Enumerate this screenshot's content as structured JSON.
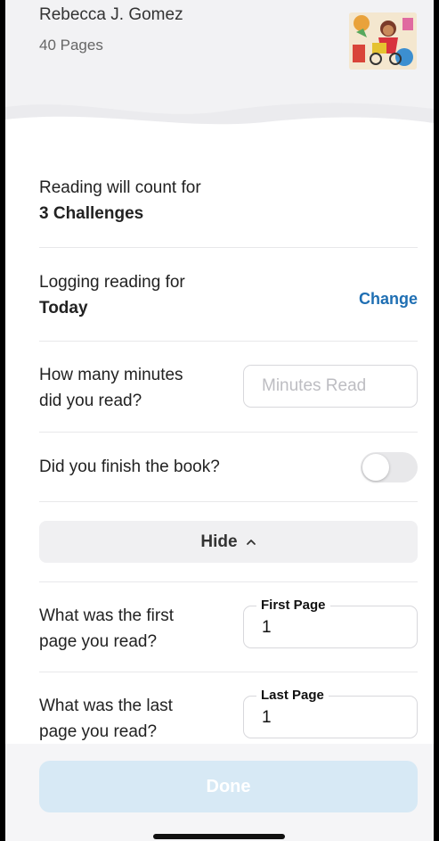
{
  "book": {
    "author": "Rebecca J. Gomez",
    "pages": "40 Pages"
  },
  "challenges": {
    "label": "Reading will count for",
    "value": "3 Challenges"
  },
  "logging": {
    "label": "Logging reading for",
    "value": "Today",
    "change_label": "Change"
  },
  "minutes": {
    "label_line1": "How many minutes",
    "label_line2": "did you read?",
    "placeholder": "Minutes Read",
    "value": ""
  },
  "finish": {
    "label": "Did you finish the book?",
    "toggle_state": "off"
  },
  "hide_button": {
    "label": "Hide"
  },
  "first_page": {
    "label_line1": "What was the first",
    "label_line2": "page you read?",
    "field_label": "First Page",
    "value": "1"
  },
  "last_page": {
    "label_line1": "What was the last",
    "label_line2": "page you read?",
    "field_label": "Last Page",
    "value": "1"
  },
  "done_button": {
    "label": "Done",
    "state": "disabled"
  },
  "colors": {
    "accent": "#1f6fb3",
    "done_disabled": "#d7e9f5",
    "header_bg": "#f2f2f4"
  }
}
